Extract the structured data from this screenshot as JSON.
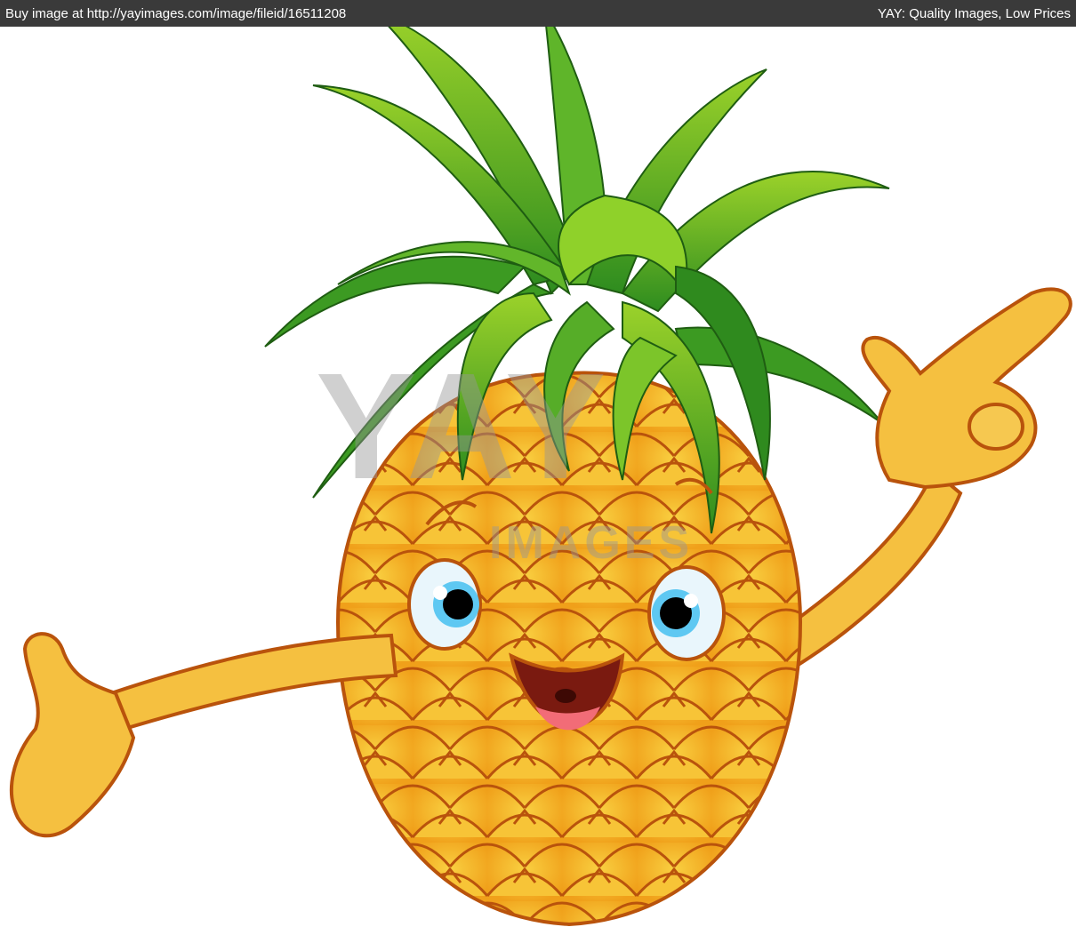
{
  "banner": {
    "left_text": "Buy image at http://yayimages.com/image/fileid/16511208",
    "right_text": "YAY: Quality Images, Low Prices"
  },
  "watermark": {
    "logo": "YAY",
    "sub": "IMAGES"
  },
  "illustration": {
    "subject": "cartoon-pineapple",
    "colors": {
      "leaf_dark": "#2f8a1e",
      "leaf_light": "#8fd12a",
      "body": "#f5b421",
      "scale_highlight": "#f7cf3b",
      "outline": "#b9530c",
      "arm": "#f5c040",
      "eye_iris": "#5ec8f2"
    }
  }
}
